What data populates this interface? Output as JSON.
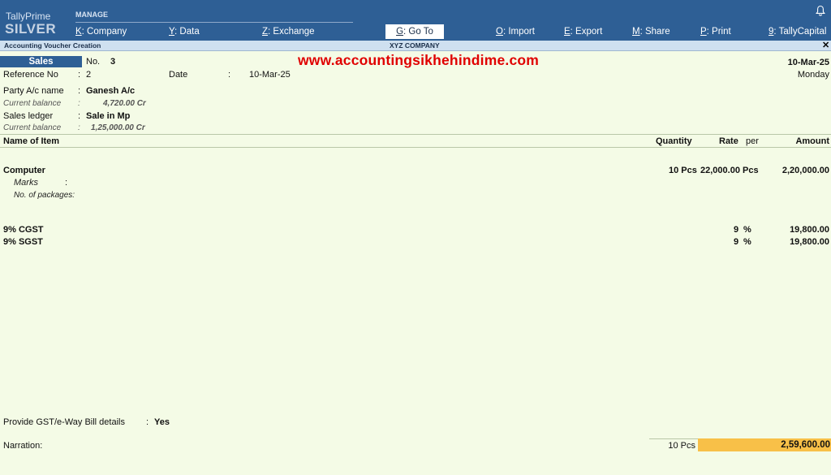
{
  "brand": {
    "line1": "TallyPrime",
    "line2": "SILVER"
  },
  "manage_label": "MANAGE",
  "menu": [
    {
      "key": "K",
      "label": ": Company"
    },
    {
      "key": "Y",
      "label": ": Data"
    },
    {
      "key": "Z",
      "label": ": Exchange"
    },
    {
      "key": "G",
      "label": ": Go To"
    },
    {
      "key": "O",
      "label": ": Import"
    },
    {
      "key": "E",
      "label": ": Export"
    },
    {
      "key": "M",
      "label": ": Share"
    },
    {
      "key": "P",
      "label": ": Print"
    },
    {
      "key": "9",
      "label": ": TallyCapital"
    }
  ],
  "subbar": {
    "screen": "Accounting Voucher Creation",
    "company": "XYZ COMPANY",
    "close": "✕"
  },
  "watermark": "www.accountingsikhehindime.com",
  "voucher": {
    "type": "Sales",
    "no_label": "No.",
    "no_value": "3",
    "date_top": "10-Mar-25",
    "day": "Monday",
    "ref_label": "Reference No",
    "ref_value": "2",
    "date_label": "Date",
    "date_value": "10-Mar-25",
    "party_label": "Party A/c name",
    "party_value": "Ganesh A/c",
    "party_bal_label": "Current balance",
    "party_bal_value": "4,720.00 Cr",
    "ledger_label": "Sales ledger",
    "ledger_value": "Sale in Mp",
    "ledger_bal_label": "Current balance",
    "ledger_bal_value": "1,25,000.00 Cr",
    "colon": ":"
  },
  "table": {
    "headers": {
      "item": "Name of Item",
      "qty": "Quantity",
      "rate": "Rate",
      "per": "per",
      "amount": "Amount"
    },
    "items": [
      {
        "name": "Computer",
        "qty": "10 Pcs",
        "rate": "22,000.00",
        "per": "Pcs",
        "amount": "2,20,000.00",
        "marks_label": "Marks",
        "packages_label": "No. of packages:"
      }
    ],
    "taxes": [
      {
        "name": "9% CGST",
        "rate": "9",
        "per": "%",
        "amount": "19,800.00"
      },
      {
        "name": "9% SGST",
        "rate": "9",
        "per": "%",
        "amount": "19,800.00"
      }
    ]
  },
  "footer": {
    "gst_label": "Provide GST/e-Way Bill details",
    "gst_value": "Yes",
    "narration_label": "Narration:",
    "total_qty": "10 Pcs",
    "total_amount": "2,59,600.00"
  }
}
